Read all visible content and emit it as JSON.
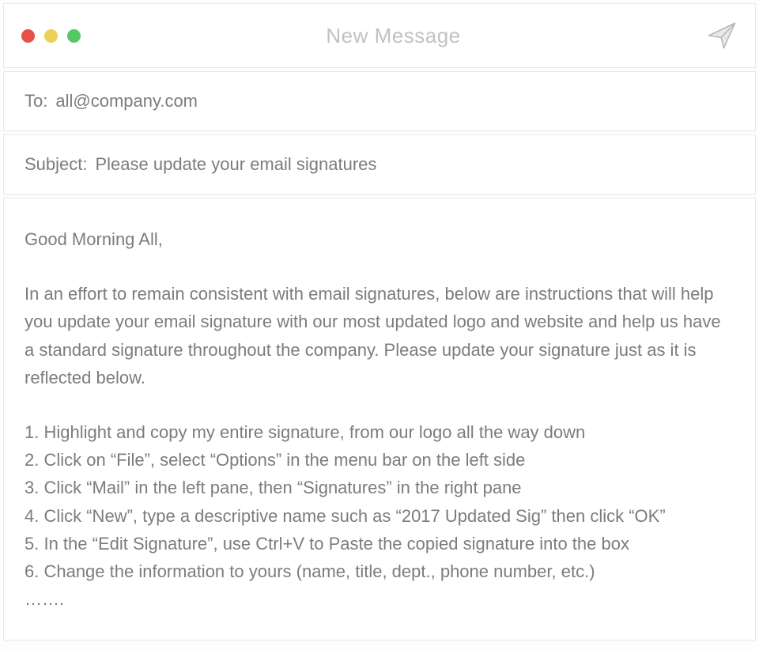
{
  "header": {
    "title": "New Message"
  },
  "fields": {
    "to_label": "To:",
    "to_value": "all@company.com",
    "subject_label": "Subject:",
    "subject_value": "Please update your email signatures"
  },
  "body": {
    "greeting": "Good Morning All,",
    "intro": "In an effort to remain consistent with email signatures, below are instructions that will help you update your email signature with our most updated logo and website and help us have a standard signature throughout the company. Please update your signature just as it is reflected below.",
    "steps": [
      "1. Highlight and copy my entire signature, from our logo all the way down",
      "2. Click on “File”, select “Options” in the menu bar on the left side",
      "3. Click “Mail” in the left pane, then “Signatures” in the right pane",
      "4. Click “New”, type a descriptive name such as “2017 Updated Sig” then click “OK”",
      "5. In the “Edit Signature”, use Ctrl+V to Paste the copied signature into the box",
      "6. Change the information to yours (name, title, dept., phone number, etc.)",
      "……."
    ]
  }
}
